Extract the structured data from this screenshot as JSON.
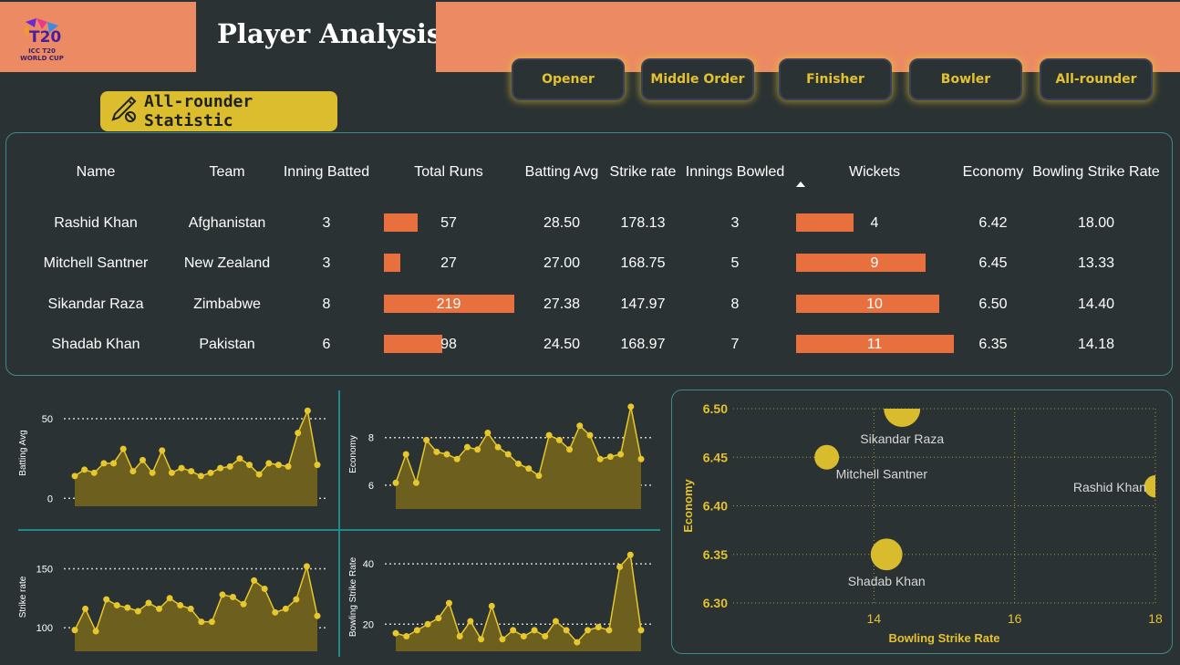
{
  "header": {
    "logo_text": "ICC T20 WORLD CUP",
    "title": "Player Analysis"
  },
  "nav": {
    "buttons": [
      "Opener",
      "Middle Order",
      "Finisher",
      "Bowler",
      "All-rounder"
    ]
  },
  "badge": {
    "label": "All-rounder Statistic",
    "icon": "cricket-bat-ball-icon"
  },
  "colors": {
    "accent": "#ec8b63",
    "bar": "#e8703e",
    "gold": "#dcbd2e",
    "background": "#2b3233",
    "teal": "#1f8a8a"
  },
  "table": {
    "columns": [
      "Name",
      "Team",
      "Inning Batted",
      "Total Runs",
      "Batting Avg",
      "Strike rate",
      "Innings Bowled",
      "Wickets",
      "Economy",
      "Bowling Strike Rate"
    ],
    "sorted_column": "Wickets",
    "rows": [
      {
        "name": "Rashid Khan",
        "team": "Afghanistan",
        "inning_batted": "3",
        "total_runs": "57",
        "batting_avg": "28.50",
        "strike_rate": "178.13",
        "innings_bowled": "3",
        "wickets": "4",
        "economy": "6.42",
        "bowling_sr": "18.00",
        "runs_value": 57,
        "wickets_value": 4
      },
      {
        "name": "Mitchell Santner",
        "team": "New Zealand",
        "inning_batted": "3",
        "total_runs": "27",
        "batting_avg": "27.00",
        "strike_rate": "168.75",
        "innings_bowled": "5",
        "wickets": "9",
        "economy": "6.45",
        "bowling_sr": "13.33",
        "runs_value": 27,
        "wickets_value": 9
      },
      {
        "name": "Sikandar Raza",
        "team": "Zimbabwe",
        "inning_batted": "8",
        "total_runs": "219",
        "batting_avg": "27.38",
        "strike_rate": "147.97",
        "innings_bowled": "8",
        "wickets": "10",
        "economy": "6.50",
        "bowling_sr": "14.40",
        "runs_value": 219,
        "wickets_value": 10
      },
      {
        "name": "Shadab Khan",
        "team": "Pakistan",
        "inning_batted": "6",
        "total_runs": "98",
        "batting_avg": "24.50",
        "strike_rate": "168.97",
        "innings_bowled": "7",
        "wickets": "11",
        "economy": "6.35",
        "bowling_sr": "14.18",
        "runs_value": 98,
        "wickets_value": 11
      }
    ],
    "runs_max": 219,
    "wickets_max": 11
  },
  "chart_data": [
    {
      "type": "area",
      "ylabel": "Batting Avg",
      "yticks": [
        0,
        50
      ],
      "ylim": [
        -5,
        62
      ],
      "values": [
        14,
        18,
        16,
        22,
        22,
        31,
        17,
        24,
        16,
        30,
        16,
        19,
        17,
        14,
        16,
        19,
        20,
        25,
        21,
        15,
        22,
        21,
        20,
        41,
        55,
        21
      ]
    },
    {
      "type": "area",
      "ylabel": "Economy",
      "yticks": [
        6,
        8
      ],
      "ylim": [
        5.0,
        9.6
      ],
      "values": [
        6.1,
        7.3,
        6.1,
        7.9,
        7.4,
        7.3,
        7.1,
        7.6,
        7.5,
        8.2,
        7.6,
        7.3,
        6.9,
        6.7,
        6.4,
        8.1,
        7.9,
        7.5,
        8.5,
        8.1,
        7.1,
        7.2,
        7.3,
        9.3,
        7.1
      ]
    },
    {
      "type": "area",
      "ylabel": "Strike rate",
      "yticks": [
        100,
        150
      ],
      "ylim": [
        80,
        172
      ],
      "values": [
        98,
        116,
        97,
        124,
        119,
        117,
        114,
        121,
        116,
        125,
        119,
        116,
        105,
        105,
        128,
        126,
        120,
        140,
        133,
        113,
        116,
        124,
        152,
        110
      ]
    },
    {
      "type": "area",
      "ylabel": "Bowling Strike Rate",
      "yticks": [
        20,
        40
      ],
      "ylim": [
        11,
        47
      ],
      "values": [
        17,
        16,
        18,
        20,
        22,
        27,
        16,
        21,
        15,
        26,
        15,
        18,
        16,
        18,
        16,
        21,
        18,
        14,
        18,
        19,
        18,
        39,
        43,
        18
      ]
    },
    {
      "type": "scatter",
      "xlabel": "Bowling Strike Rate",
      "ylabel": "Economy",
      "xlim": [
        12,
        18
      ],
      "ylim": [
        6.3,
        6.5
      ],
      "xticks": [
        14,
        16,
        18
      ],
      "yticks": [
        6.3,
        6.35,
        6.4,
        6.45,
        6.5
      ],
      "points": [
        {
          "label": "Sikandar Raza",
          "x": 14.4,
          "y": 6.5,
          "size": 10
        },
        {
          "label": "Mitchell Santner",
          "x": 13.33,
          "y": 6.45,
          "size": 5
        },
        {
          "label": "Rashid Khan",
          "x": 18.0,
          "y": 6.42,
          "size": 4
        },
        {
          "label": "Shadab Khan",
          "x": 14.18,
          "y": 6.35,
          "size": 8
        }
      ]
    }
  ]
}
